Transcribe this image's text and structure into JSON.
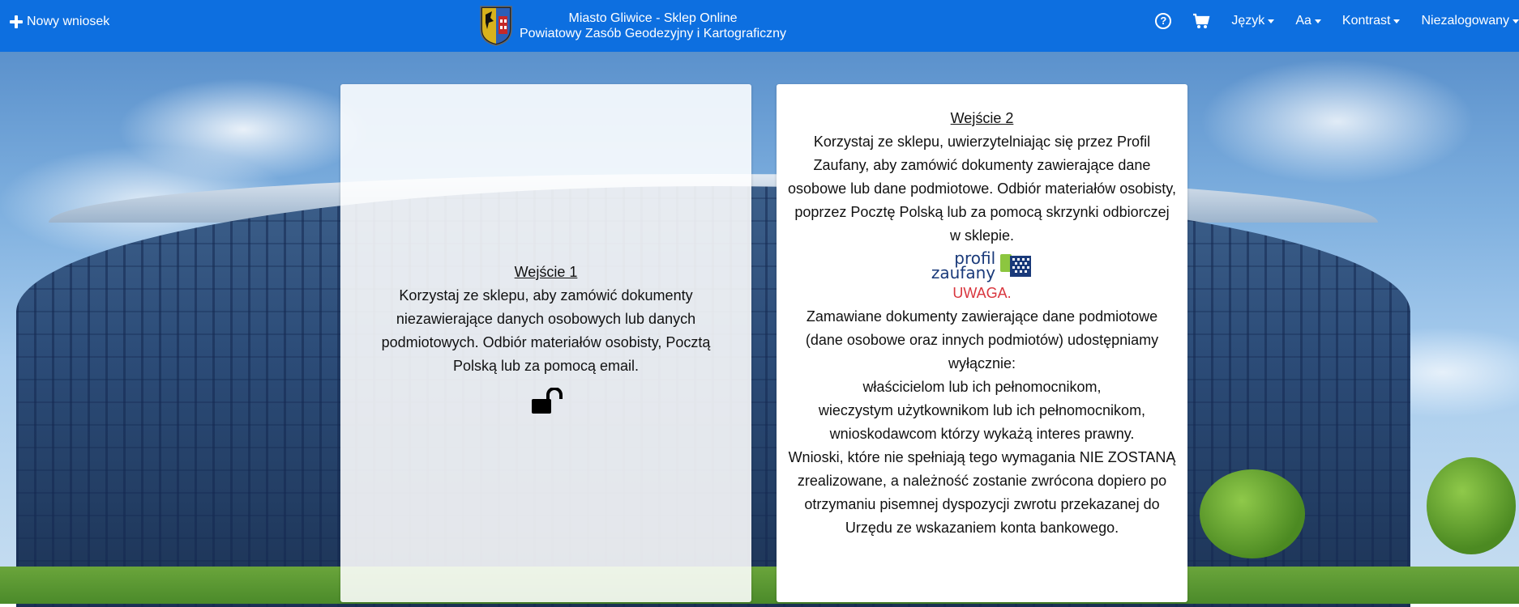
{
  "navbar": {
    "new_request_label": "Nowy wniosek",
    "brand_line1": "Miasto Gliwice - Sklep Online",
    "brand_line2": "Powiatowy Zasób Geodezyjny i Kartograficzny",
    "language_label": "Język",
    "font_size_label": "Aa",
    "contrast_label": "Kontrast",
    "user_label": "Niezalogowany"
  },
  "entry1": {
    "title": "Wejście 1",
    "description": "Korzystaj ze sklepu, aby zamówić dokumenty niezawierające danych osobowych lub danych podmiotowych. Odbiór materiałów osobisty, Pocztą Polską lub za pomocą email."
  },
  "entry2": {
    "title": "Wejście 2",
    "description": "Korzystaj ze sklepu, uwierzytelniając się przez Profil Zaufany, aby zamówić dokumenty zawierające dane osobowe lub dane podmiotowe. Odbiór materiałów osobisty, poprzez Pocztę Polską lub za pomocą skrzynki odbiorczej w sklepie.",
    "logo_line1": "profil",
    "logo_line2": "zaufany",
    "warning_label": "UWAGA.",
    "warning_intro": "Zamawiane dokumenty zawierające dane podmiotowe (dane osobowe oraz innych podmiotów) udostępniamy wyłącznie:",
    "recipients": [
      "właścicielom lub ich pełnomocnikom,",
      "wieczystym użytkownikom lub ich pełnomocnikom,",
      "wnioskodawcom którzy wykażą interes prawny."
    ],
    "warning_outro": "Wnioski, które nie spełniają tego wymagania NIE ZOSTANĄ zrealizowane, a należność zostanie zwrócona dopiero po otrzymaniu pisemnej dyspozycji zwrotu przekazanej do Urzędu ze wskazaniem konta bankowego."
  },
  "colors": {
    "navbar": "#0d6fe0",
    "warning": "#d9363e",
    "logo_blue": "#1a3a7a",
    "logo_green": "#8cc63f"
  },
  "icons": [
    "plus-icon",
    "crest-logo",
    "help-icon",
    "cart-icon",
    "unlock-icon",
    "profil-zaufany-logo"
  ]
}
